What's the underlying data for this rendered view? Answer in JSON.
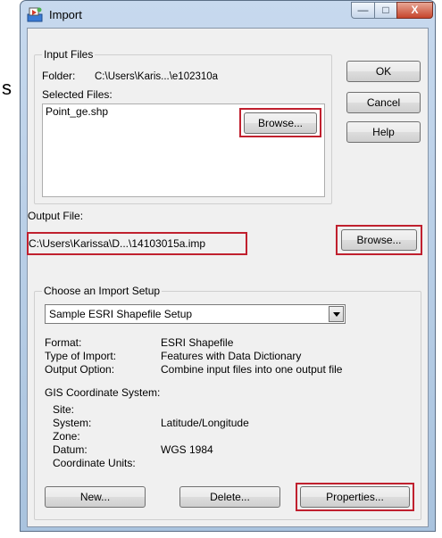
{
  "backdrop": {
    "stray_text": "s"
  },
  "window": {
    "title": "Import",
    "controls": {
      "minimize": "—",
      "maximize": "□",
      "close": "X"
    }
  },
  "input_files": {
    "legend": "Input Files",
    "folder_label": "Folder:",
    "folder_value": "C:\\Users\\Karis...\\e102310a",
    "selected_label": "Selected Files:",
    "files": [
      "Point_ge.shp"
    ],
    "browse_label": "Browse..."
  },
  "side_buttons": {
    "ok": "OK",
    "cancel": "Cancel",
    "help": "Help"
  },
  "output_file": {
    "label": "Output File:",
    "value": "C:\\Users\\Karissa\\D...\\14103015a.imp",
    "browse_label": "Browse..."
  },
  "setup": {
    "legend": "Choose an Import Setup",
    "selected": "Sample ESRI Shapefile Setup",
    "format_label": "Format:",
    "format_value": "ESRI Shapefile",
    "type_label": "Type of Import:",
    "type_value": "Features with Data Dictionary",
    "output_label": "Output Option:",
    "output_value": "Combine input files into one output file",
    "gis_label": "GIS Coordinate System:",
    "site_label": "Site:",
    "site_value": "",
    "system_label": "System:",
    "system_value": "Latitude/Longitude",
    "zone_label": "Zone:",
    "zone_value": "",
    "datum_label": "Datum:",
    "datum_value": "WGS 1984",
    "units_label": "Coordinate Units:",
    "units_value": "",
    "new_label": "New...",
    "delete_label": "Delete...",
    "properties_label": "Properties..."
  },
  "colors": {
    "highlight": "#c0202e",
    "dialog_bg": "#f0f0f0",
    "close_button": "#c6452c"
  }
}
